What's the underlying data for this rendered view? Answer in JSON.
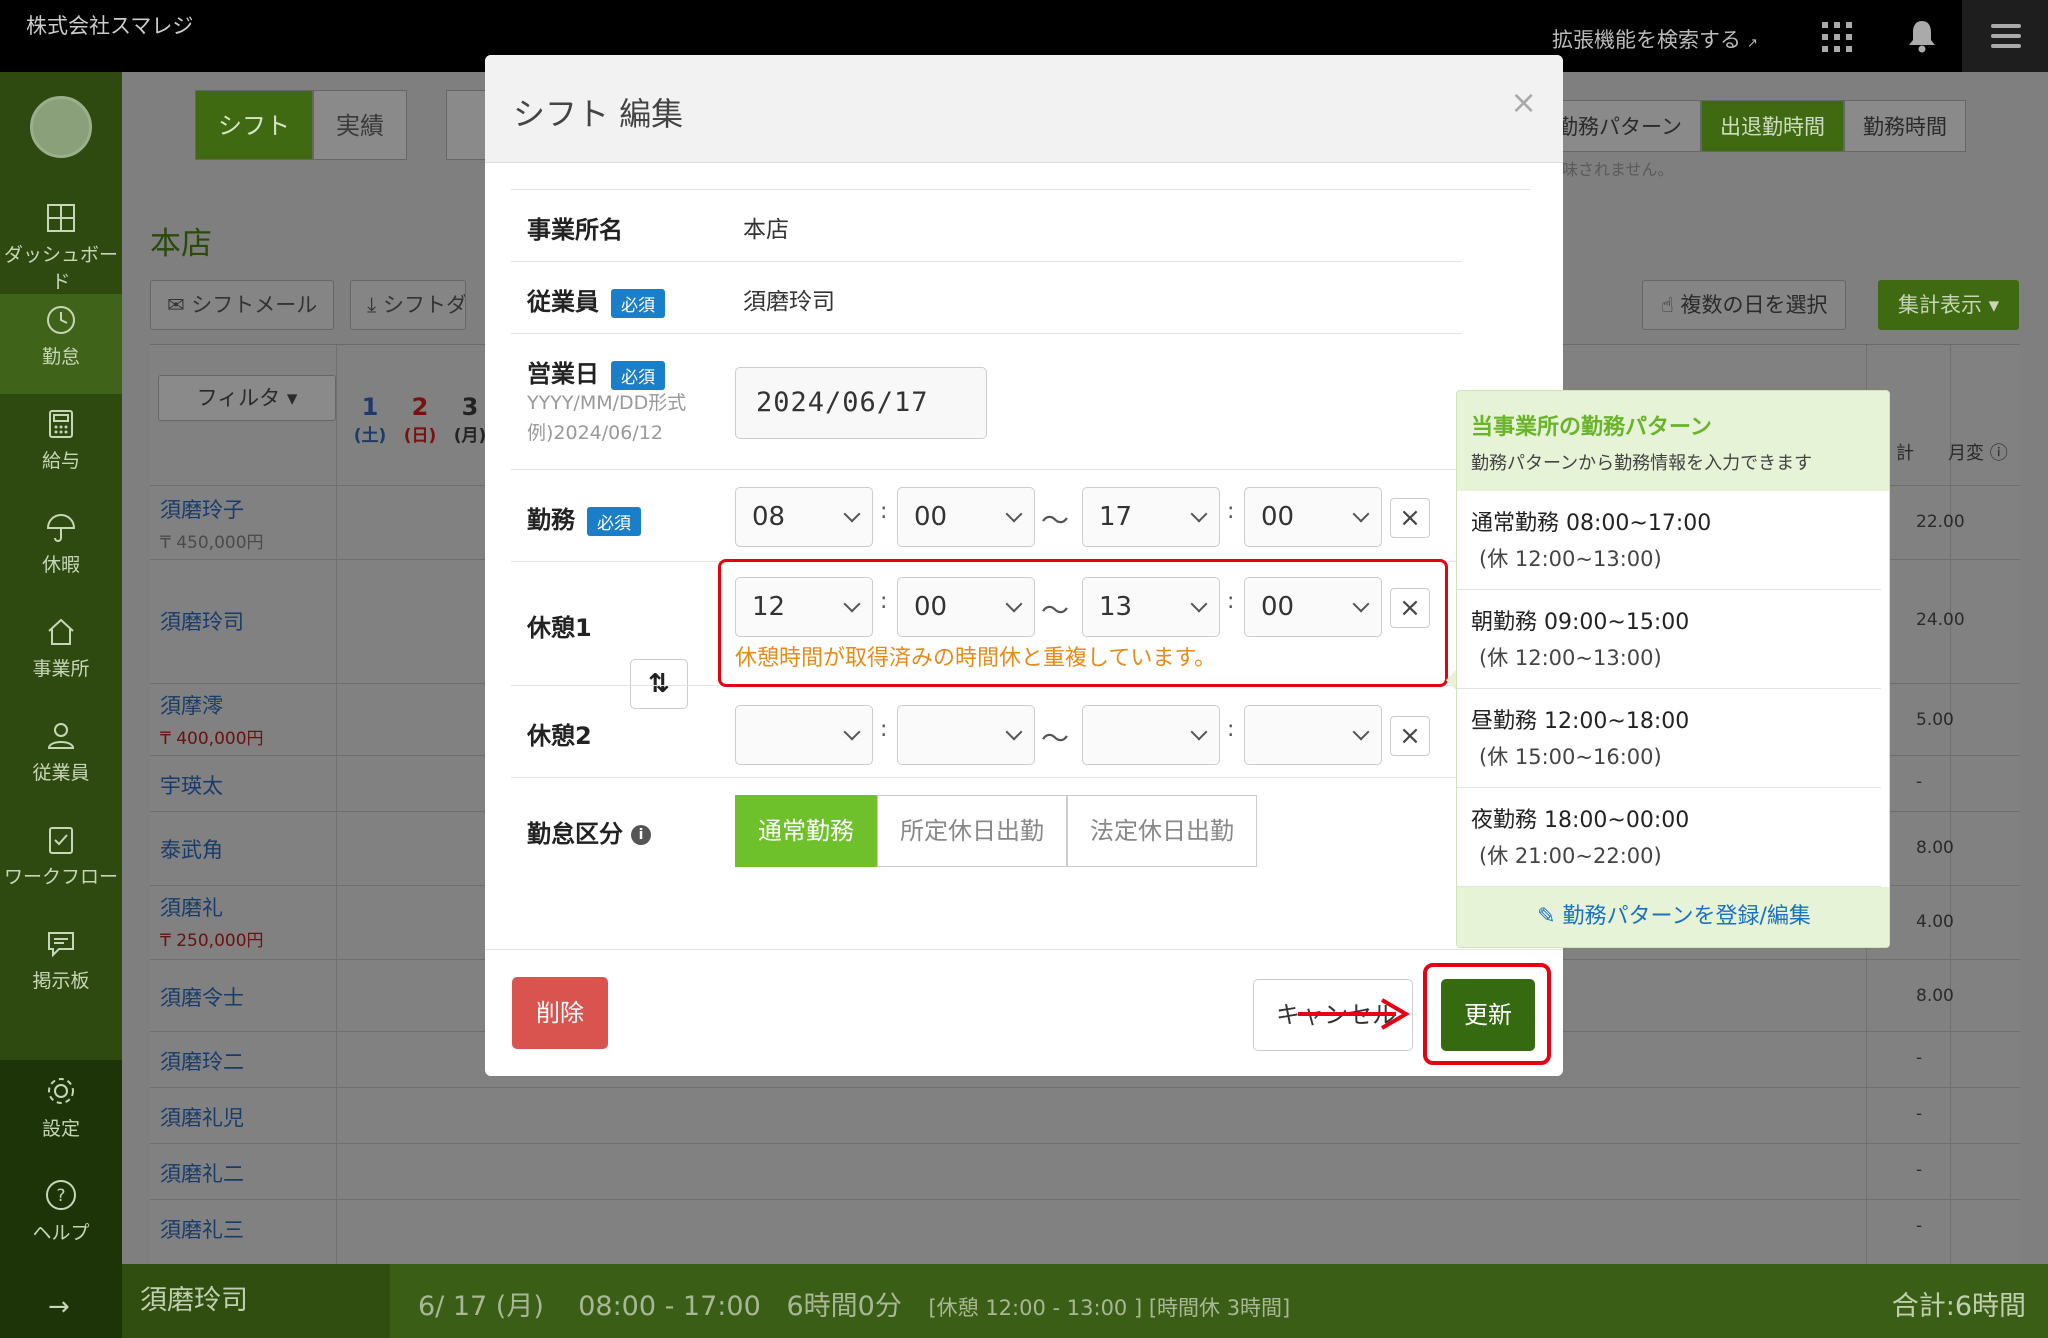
{
  "topbar": {
    "company": "株式会社スマレジ",
    "ext_search": "拡張機能を検索する",
    "ext_icon": "↗"
  },
  "sidebar": {
    "items": [
      {
        "label": "ダッシュボード",
        "icon": "dashboard-icon"
      },
      {
        "label": "勤怠",
        "icon": "clock-icon"
      },
      {
        "label": "給与",
        "icon": "calculator-icon"
      },
      {
        "label": "休暇",
        "icon": "umbrella-icon"
      },
      {
        "label": "事業所",
        "icon": "home-icon"
      },
      {
        "label": "従業員",
        "icon": "user-icon"
      },
      {
        "label": "ワークフロー",
        "icon": "checklist-icon"
      },
      {
        "label": "掲示板",
        "icon": "message-icon"
      },
      {
        "label": "設定",
        "icon": "gear-icon"
      },
      {
        "label": "ヘルプ",
        "icon": "help-icon"
      }
    ],
    "expand_icon": "→"
  },
  "page": {
    "tabs": [
      "シフト",
      "実績"
    ],
    "store_title": "本店",
    "shift_mail": "シフトメール",
    "shift_download": "シフトダ",
    "right_tabs": [
      "勤務パターン",
      "出退勤時間",
      "勤務時間"
    ],
    "right_note": "味されません。",
    "multi_select": "複数の日を選択",
    "summary": "集計表示",
    "filter": "フィルタ",
    "days": [
      {
        "num": "1",
        "week": "(土)"
      },
      {
        "num": "2",
        "week": "(日)"
      },
      {
        "num": "3",
        "week": "(月)"
      }
    ],
    "col_total": "計",
    "col_month": "月変",
    "employees": [
      {
        "name": "須磨玲子",
        "salary": "₸ 450,000円",
        "total": "22.00"
      },
      {
        "name": "須磨玲司",
        "salary": "",
        "total": "24.00"
      },
      {
        "name": "須摩澪",
        "salary": "₸ 400,000円",
        "total": "5.00"
      },
      {
        "name": "宇瑛太",
        "salary": "",
        "total": "-"
      },
      {
        "name": "泰武角",
        "salary": "",
        "total": "8.00"
      },
      {
        "name": "須磨礼",
        "salary": "₸ 250,000円",
        "total": "4.00"
      },
      {
        "name": "須磨令士",
        "salary": "",
        "total": "8.00"
      },
      {
        "name": "須磨玲二",
        "salary": "",
        "total": "-"
      },
      {
        "name": "須磨礼児",
        "salary": "",
        "total": "-"
      },
      {
        "name": "須磨礼二",
        "salary": "",
        "total": "-"
      },
      {
        "name": "須磨礼三",
        "salary": "",
        "total": "-"
      }
    ]
  },
  "statusbar": {
    "name": "須磨玲司",
    "date": "6/ 17 (月)",
    "time": "08:00 - 17:00",
    "duration": "6時間0分",
    "detail": "[休憩 12:00 - 13:00 ] [時間休 3時間]",
    "total": "合計:6時間"
  },
  "modal": {
    "title": "シフト 編集",
    "close": "×",
    "required": "必須",
    "office_label": "事業所名",
    "office_value": "本店",
    "employee_label": "従業員",
    "employee_value": "須磨玲司",
    "date_label": "営業日",
    "date_hint_1": "YYYY/MM/DD形式",
    "date_hint_2": "例)2024/06/12",
    "date_value": "2024/06/17",
    "work_label": "勤務",
    "work": {
      "sh": "08",
      "sm": "00",
      "eh": "17",
      "em": "00"
    },
    "break1_label": "休憩1",
    "break1": {
      "sh": "12",
      "sm": "00",
      "eh": "13",
      "em": "00"
    },
    "break1_error": "休憩時間が取得済みの時間休と重複しています。",
    "break2_label": "休憩2",
    "break2": {
      "sh": "",
      "sm": "",
      "eh": "",
      "em": ""
    },
    "colon": ":",
    "tilde": "〜",
    "clear": "×",
    "swap": "⇅",
    "category_label": "勤怠区分",
    "categories": [
      "通常勤務",
      "所定休日出勤",
      "法定休日出勤"
    ],
    "delete": "削除",
    "cancel": "キャンセル",
    "update": "更新"
  },
  "patterns": {
    "title": "当事業所の勤務パターン",
    "subtitle": "勤務パターンから勤務情報を入力できます",
    "items": [
      {
        "name": "通常勤務 08:00~17:00",
        "break": "(休 12:00~13:00)"
      },
      {
        "name": "朝勤務 09:00~15:00",
        "break": "(休 12:00~13:00)"
      },
      {
        "name": "昼勤務 12:00~18:00",
        "break": "(休 15:00~16:00)"
      },
      {
        "name": "夜勤務 18:00~00:00",
        "break": "(休 21:00~22:00)"
      }
    ],
    "footer": "✎ 勤務パターンを登録/編集"
  },
  "colors": {
    "accent_green": "#6ec12a",
    "dark_green": "#356a10",
    "required_blue": "#1a7ec8",
    "error_orange": "#e68a1a",
    "highlight_red": "#e60012",
    "delete_red": "#d9534f"
  }
}
